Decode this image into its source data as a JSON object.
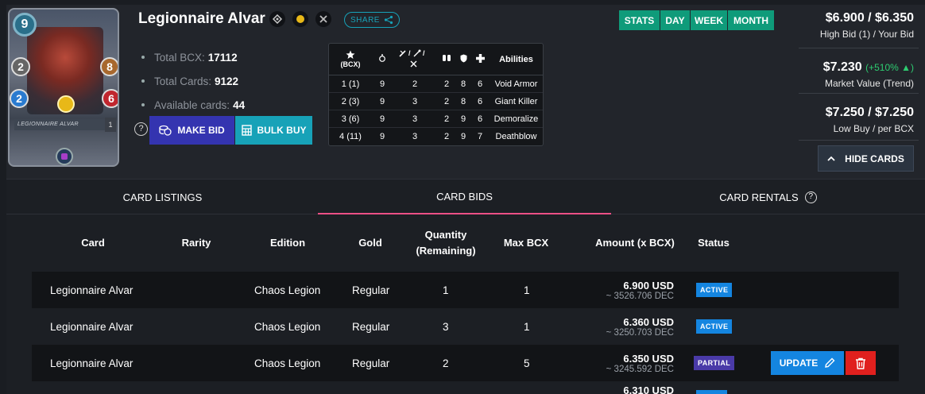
{
  "card": {
    "name": "Legionnaire Alvar",
    "mana": "9",
    "melee": "2",
    "speed": "8",
    "armor": "2",
    "health": "6",
    "level": "1",
    "img_name": "LEGIONNAIRE ALVAR"
  },
  "share_label": "SHARE",
  "stats": {
    "total_bcx_label": "Total BCX:",
    "total_bcx": "17112",
    "total_cards_label": "Total Cards:",
    "total_cards": "9122",
    "available_label": "Available cards:",
    "available": "44"
  },
  "buttons": {
    "make_bid": "MAKE BID",
    "bulk_buy": "BULK BUY",
    "help": "?"
  },
  "level_table": {
    "bcx_label": "(BCX)",
    "abilities_label": "Abilities",
    "attack_label": "/ /",
    "rows": [
      {
        "lvl": "1 (1)",
        "speed": "9",
        "attack": "2",
        "armor": "2",
        "shield": "8",
        "health": "6",
        "ability": "Void Armor"
      },
      {
        "lvl": "2 (3)",
        "speed": "9",
        "attack": "3",
        "armor": "2",
        "shield": "8",
        "health": "6",
        "ability": "Giant Killer"
      },
      {
        "lvl": "3 (6)",
        "speed": "9",
        "attack": "3",
        "armor": "2",
        "shield": "9",
        "health": "6",
        "ability": "Demoralize"
      },
      {
        "lvl": "4 (11)",
        "speed": "9",
        "attack": "3",
        "armor": "2",
        "shield": "9",
        "health": "7",
        "ability": "Deathblow"
      }
    ]
  },
  "periods": [
    "STATS",
    "DAY",
    "WEEK",
    "MONTH"
  ],
  "prices": {
    "bid": "$6.900 / $6.350",
    "bid_label": "High Bid (1) / Your Bid",
    "market": "$7.230",
    "market_trend": "(+510% ▲)",
    "market_label": "Market Value (Trend)",
    "low": "$7.250 / $7.250",
    "low_label": "Low Buy / per BCX"
  },
  "hide_cards": "HIDE CARDS",
  "tabs": {
    "listings": "CARD LISTINGS",
    "bids": "CARD BIDS",
    "rentals": "CARD RENTALS",
    "rentals_help": "?"
  },
  "table": {
    "headers": {
      "card": "Card",
      "rarity": "Rarity",
      "edition": "Edition",
      "gold": "Gold",
      "quantity": "Quantity",
      "remaining": "(Remaining)",
      "max_bcx": "Max BCX",
      "amount": "Amount (x BCX)",
      "status": "Status"
    },
    "rows": [
      {
        "card": "Legionnaire Alvar",
        "edition": "Chaos Legion",
        "gold": "Regular",
        "qty": "1",
        "max": "1",
        "usd": "6.900 USD",
        "dec": "~ 3526.706 DEC",
        "status": "ACTIVE"
      },
      {
        "card": "Legionnaire Alvar",
        "edition": "Chaos Legion",
        "gold": "Regular",
        "qty": "3",
        "max": "1",
        "usd": "6.360 USD",
        "dec": "~ 3250.703 DEC",
        "status": "ACTIVE"
      },
      {
        "card": "Legionnaire Alvar",
        "edition": "Chaos Legion",
        "gold": "Regular",
        "qty": "2",
        "max": "5",
        "usd": "6.350 USD",
        "dec": "~ 3245.592 DEC",
        "status": "PARTIAL"
      },
      {
        "usd": "6.310 USD"
      }
    ],
    "update_label": "UPDATE"
  },
  "colors": {
    "teal": "#0f9b7a",
    "cyan": "#17a2b8",
    "active": "#1485e0",
    "partial": "#4a3aa8",
    "tab_underline": "#ec4f86",
    "delete": "#e0201e"
  }
}
